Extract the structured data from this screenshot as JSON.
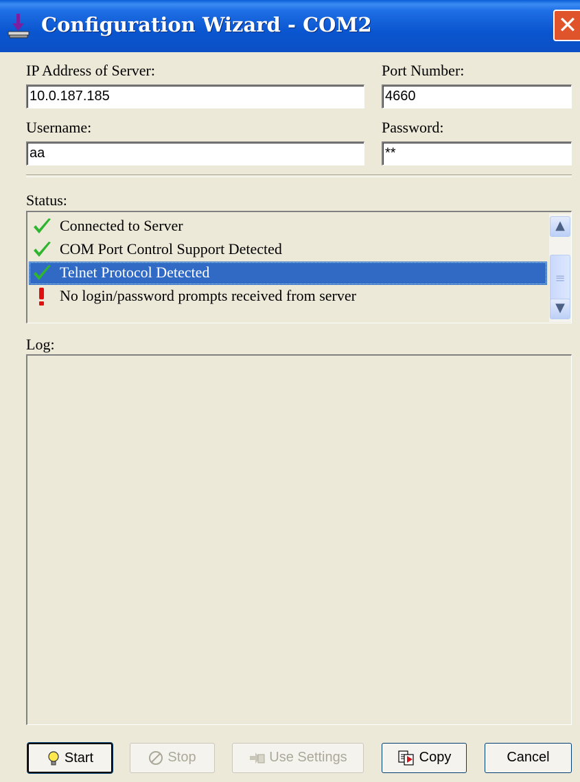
{
  "window": {
    "title": "Configuration Wizard - COM2",
    "close_label": "✕"
  },
  "fields": {
    "ip_label": "IP Address of Server:",
    "ip_value": "10.0.187.185",
    "port_label": "Port Number:",
    "port_value": "4660",
    "username_label": "Username:",
    "username_value": "aa",
    "password_label": "Password:",
    "password_value": "**"
  },
  "status": {
    "label": "Status:",
    "items": [
      {
        "text": "Connected to Server",
        "icon": "check-icon",
        "selected": false
      },
      {
        "text": "COM Port Control Support Detected",
        "icon": "check-icon",
        "selected": false
      },
      {
        "text": "Telnet Protocol Detected",
        "icon": "check-icon",
        "selected": true
      },
      {
        "text": "No login/password prompts received from server",
        "icon": "exclamation-icon",
        "selected": false
      }
    ]
  },
  "log": {
    "label": "Log:"
  },
  "buttons": {
    "start": "Start",
    "stop": "Stop",
    "use_settings": "Use Settings",
    "copy": "Copy",
    "cancel": "Cancel"
  },
  "colors": {
    "title_bar": "#0a56d0",
    "selection": "#316ac5",
    "check": "#2fb52f",
    "warning": "#e01010"
  }
}
